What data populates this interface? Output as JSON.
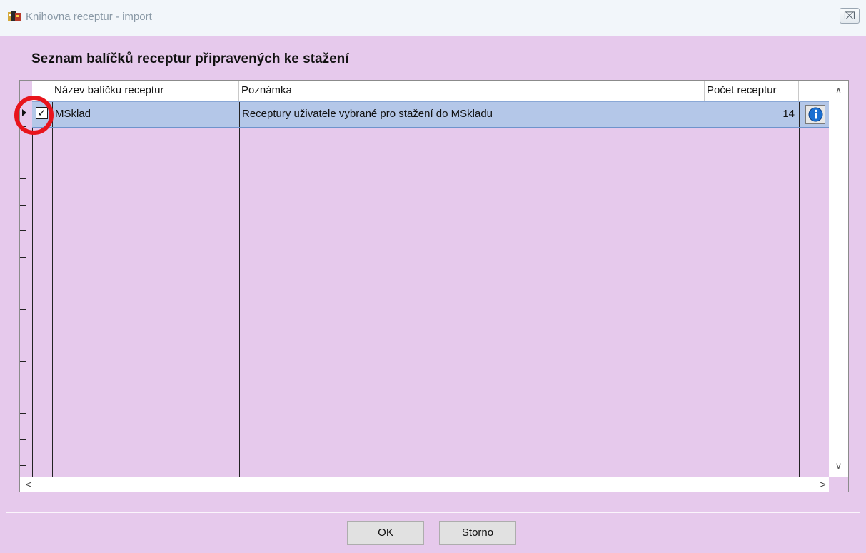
{
  "window": {
    "title": "Knihovna receptur - import",
    "close_symbol": "⌧",
    "icon": "app-icon"
  },
  "heading": "Seznam balíčků receptur připravených ke stažení",
  "table": {
    "columns": [
      "Název balíčku receptur",
      "Poznámka",
      "Počet receptur",
      ""
    ],
    "rows": [
      {
        "checked": true,
        "name": "MSklad",
        "note": "Receptury uživatele vybrané pro stažení do MSkladu",
        "count": "14",
        "action_icon": "info-icon"
      }
    ]
  },
  "scrollbar": {
    "up": "∧",
    "down": "∨",
    "left": "<",
    "right": ">"
  },
  "buttons": {
    "ok_accesskey": "O",
    "ok_rest": "K",
    "storno_accesskey": "S",
    "storno_rest": "torno"
  },
  "colors": {
    "background": "#e6c9ec",
    "selected_row": "#b4c7e8",
    "highlight_circle": "#e8141c",
    "info_icon": "#1a6fd1"
  }
}
